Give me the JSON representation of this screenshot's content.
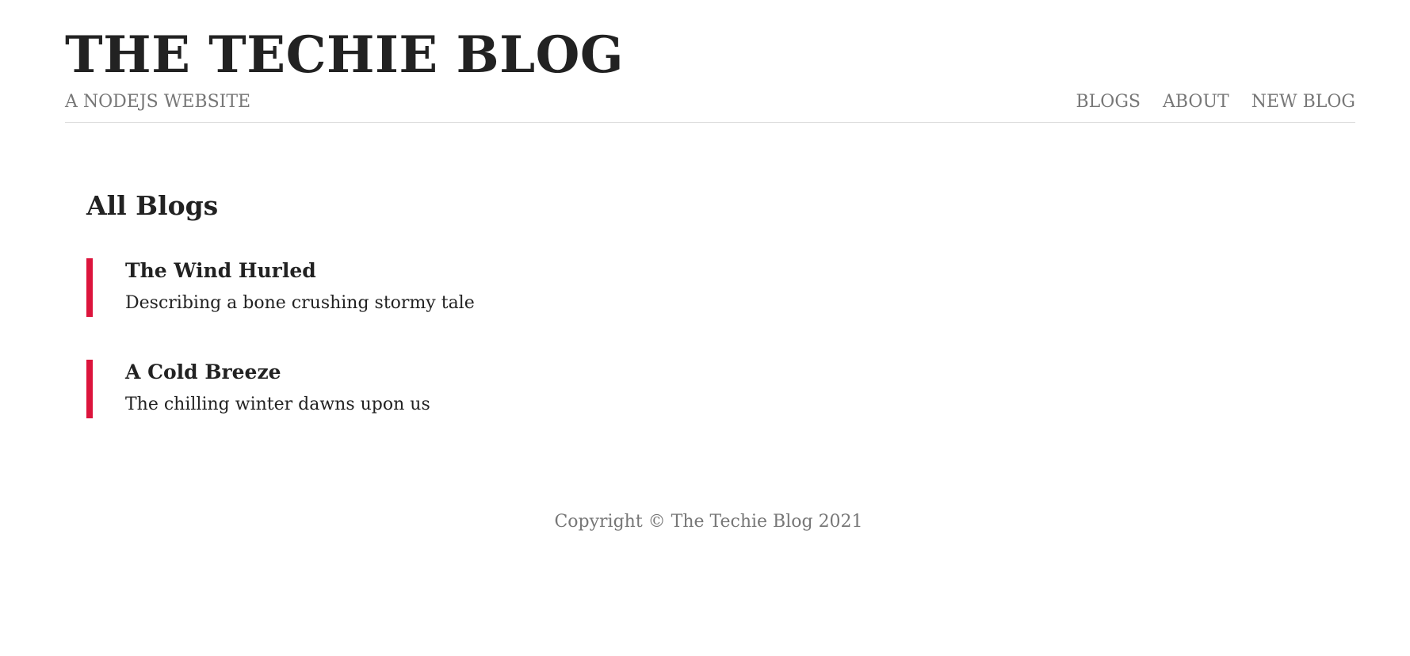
{
  "header": {
    "title": "THE TECHIE BLOG",
    "subtitle": "A NODEJS WEBSITE",
    "nav": [
      {
        "label": "BLOGS"
      },
      {
        "label": "ABOUT"
      },
      {
        "label": "NEW BLOG"
      }
    ]
  },
  "main": {
    "page_title": "All Blogs",
    "blogs": [
      {
        "title": "The Wind Hurled",
        "snippet": "Describing a bone crushing stormy tale"
      },
      {
        "title": "A Cold Breeze",
        "snippet": "The chilling winter dawns upon us"
      }
    ]
  },
  "footer": {
    "text": "Copyright © The Techie Blog 2021"
  },
  "colors": {
    "accent": "#dc143c",
    "text": "#222222",
    "muted": "#777777"
  }
}
